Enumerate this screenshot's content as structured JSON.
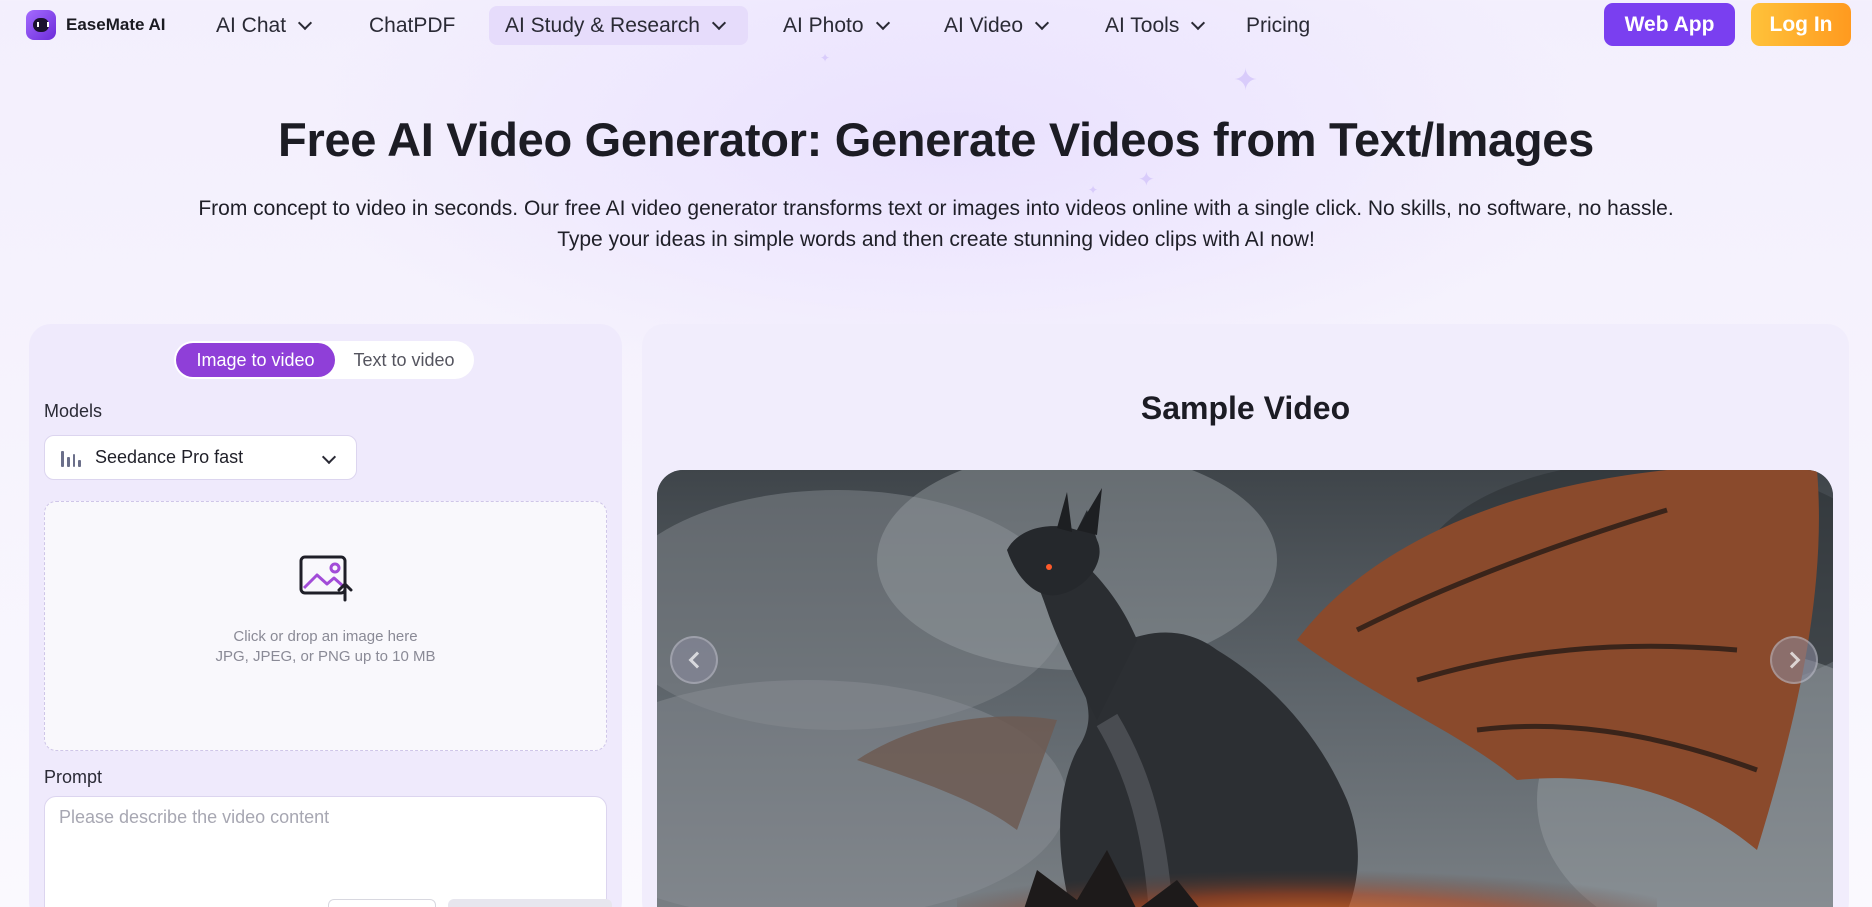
{
  "brand": {
    "name": "EaseMate AI"
  },
  "nav": {
    "items": [
      {
        "label": "AI Chat",
        "has_dropdown": true
      },
      {
        "label": "ChatPDF",
        "has_dropdown": false
      },
      {
        "label": "AI Study & Research",
        "has_dropdown": true,
        "active": true
      },
      {
        "label": "AI Photo",
        "has_dropdown": true
      },
      {
        "label": "AI Video",
        "has_dropdown": true
      },
      {
        "label": "AI Tools",
        "has_dropdown": true
      },
      {
        "label": "Pricing",
        "has_dropdown": false
      }
    ],
    "web_app_label": "Web App",
    "login_label": "Log In"
  },
  "hero": {
    "title": "Free AI Video Generator: Generate Videos from Text/Images",
    "subtitle": "From concept to video in seconds. Our free AI video generator transforms text or images into videos online with a single click. No skills, no software, no hassle. Type your ideas in simple words and then create stunning video clips with AI now!"
  },
  "generator": {
    "tabs": [
      {
        "label": "Image to video",
        "active": true
      },
      {
        "label": "Text to video",
        "active": false
      }
    ],
    "models_label": "Models",
    "model_selected": "Seedance Pro fast",
    "upload": {
      "line1": "Click or drop an image here",
      "line2": "JPG, JPEG, or PNG up to 10 MB"
    },
    "prompt_label": "Prompt",
    "prompt_placeholder": "Please describe the video content"
  },
  "sample": {
    "title": "Sample Video"
  },
  "colors": {
    "accent": "#7a3ff0",
    "tab_active": "#8f3fd8",
    "login": "#ffb02e",
    "panel_bg": "#efeafc"
  }
}
